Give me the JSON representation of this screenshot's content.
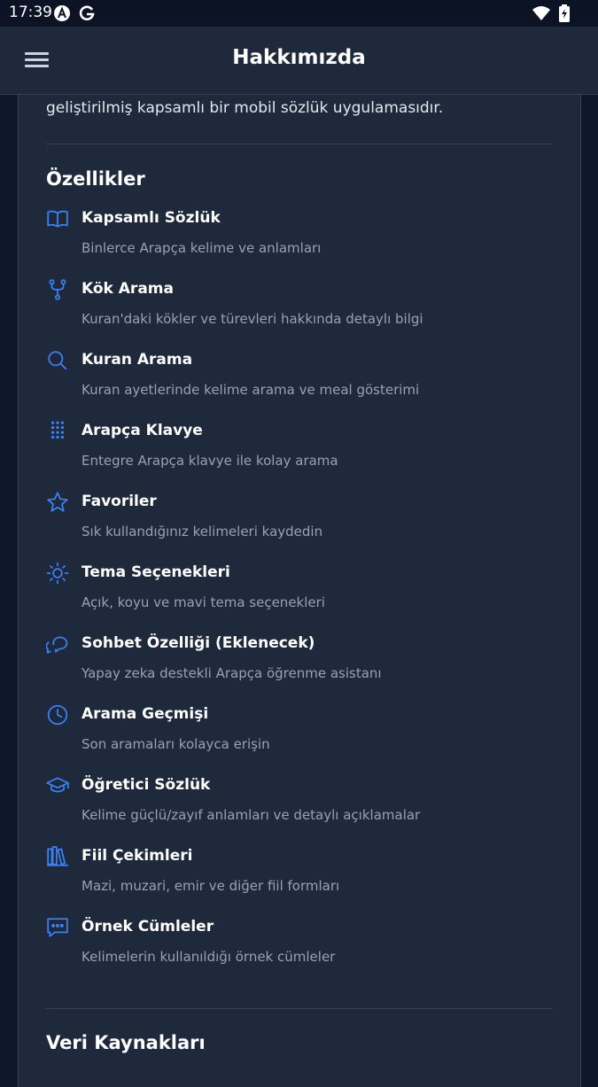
{
  "status_bar": {
    "time": "17:39",
    "left_icons": [
      "android-a-icon",
      "google-g-icon"
    ],
    "right_icons": [
      "wifi-icon",
      "battery-charging-icon"
    ]
  },
  "app_bar": {
    "menu_icon": "hamburger-menu-icon",
    "title": "Hakkımızda"
  },
  "content": {
    "intro_text": "geliştirilmiş kapsamlı bir mobil sözlük uygulamasıdır.",
    "features_title": "Özellikler",
    "features": [
      {
        "icon": "book-open-icon",
        "title": "Kapsamlı Sözlük",
        "desc": "Binlerce Arapça kelime ve anlamları"
      },
      {
        "icon": "git-fork-icon",
        "title": "Kök Arama",
        "desc": "Kuran'daki kökler ve türevleri hakkında detaylı bilgi"
      },
      {
        "icon": "search-icon",
        "title": "Kuran Arama",
        "desc": "Kuran ayetlerinde kelime arama ve meal gösterimi"
      },
      {
        "icon": "keypad-icon",
        "title": "Arapça Klavye",
        "desc": "Entegre Arapça klavye ile kolay arama"
      },
      {
        "icon": "star-icon",
        "title": "Favoriler",
        "desc": "Sık kullandığınız kelimeleri kaydedin"
      },
      {
        "icon": "sun-icon",
        "title": "Tema Seçenekleri",
        "desc": "Açık, koyu ve mavi tema seçenekleri"
      },
      {
        "icon": "chat-bubbles-icon",
        "title": "Sohbet Özelliği (Eklenecek)",
        "desc": "Yapay zeka destekli Arapça öğrenme asistanı"
      },
      {
        "icon": "clock-icon",
        "title": "Arama Geçmişi",
        "desc": "Son aramaları kolayca erişin"
      },
      {
        "icon": "graduation-cap-icon",
        "title": "Öğretici Sözlük",
        "desc": "Kelime güçlü/zayıf anlamları ve detaylı açıklamalar"
      },
      {
        "icon": "library-books-icon",
        "title": "Fiil Çekimleri",
        "desc": "Mazi, muzari, emir ve diğer fiil formları"
      },
      {
        "icon": "message-dots-icon",
        "title": "Örnek Cümleler",
        "desc": "Kelimelerin kullanıldığı örnek cümleler"
      }
    ],
    "data_sources_title": "Veri Kaynakları"
  },
  "colors": {
    "background": "#0f172a",
    "surface": "#1e293b",
    "accent_icon": "#3b82f6",
    "text_primary": "#ffffff",
    "text_secondary": "#94a3b8"
  }
}
